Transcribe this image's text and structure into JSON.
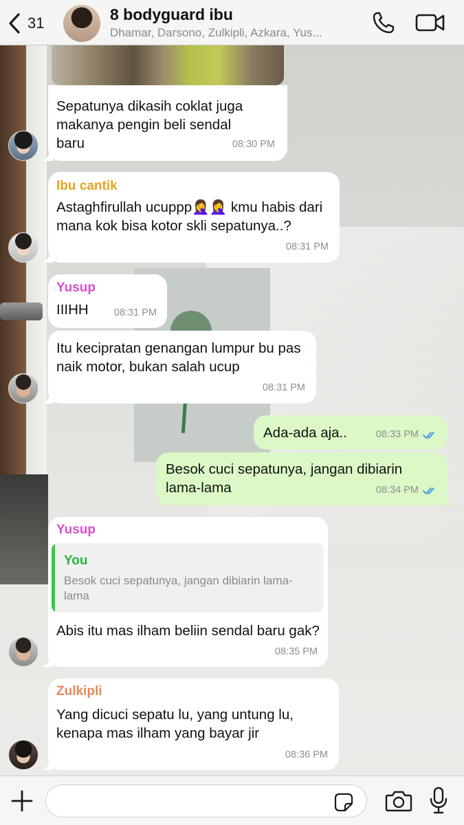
{
  "header": {
    "back_count": "31",
    "title": "8 bodyguard ibu",
    "members": "Dhamar, Darsono, Zulkipli, Azkara, Yus..."
  },
  "colors": {
    "outgoing_bubble": "#dcf8c6",
    "incoming_bubble": "#ffffff",
    "sender_ibu_cantik": "#e8a21e",
    "sender_yusup": "#d84fd0",
    "sender_zulkipli": "#e8885a",
    "quote_author": "#2bb53c",
    "read_ticks": "#3b8ee8"
  },
  "messages": [
    {
      "text": "Sepatunya dikasih coklat juga makanya pengin beli sendal baru",
      "time": "08:30 PM"
    },
    {
      "sender": "Ibu cantik",
      "text": "Astaghfirullah ucuppp🤦‍♀️🤦‍♀️ kmu habis dari mana kok bisa kotor skli sepatunya..?",
      "time": "08:31 PM"
    },
    {
      "sender": "Yusup",
      "text": "IIIHH",
      "time": "08:31 PM"
    },
    {
      "text": "Itu kecipratan genangan lumpur bu pas naik motor, bukan salah ucup",
      "time": "08:31 PM"
    },
    {
      "text": "Ada-ada aja..",
      "time": "08:33 PM"
    },
    {
      "text": "Besok cuci sepatunya, jangan dibiarin lama-lama",
      "time": "08:34 PM"
    },
    {
      "sender": "Yusup",
      "quote_author": "You",
      "quote_text": "Besok cuci sepatunya, jangan dibiarin lama-lama",
      "text": "Abis itu mas ilham beliin sendal baru gak?",
      "time": "08:35 PM"
    },
    {
      "sender": "Zulkipli",
      "text": "Yang dicuci sepatu lu, yang untung lu, kenapa mas ilham yang bayar jir",
      "time": "08:36 PM"
    }
  ],
  "icons": {
    "back": "chevron-left-icon",
    "call": "phone-icon",
    "video": "video-camera-icon",
    "plus": "plus-icon",
    "sticker": "sticker-icon",
    "camera": "camera-icon",
    "mic": "microphone-icon"
  }
}
